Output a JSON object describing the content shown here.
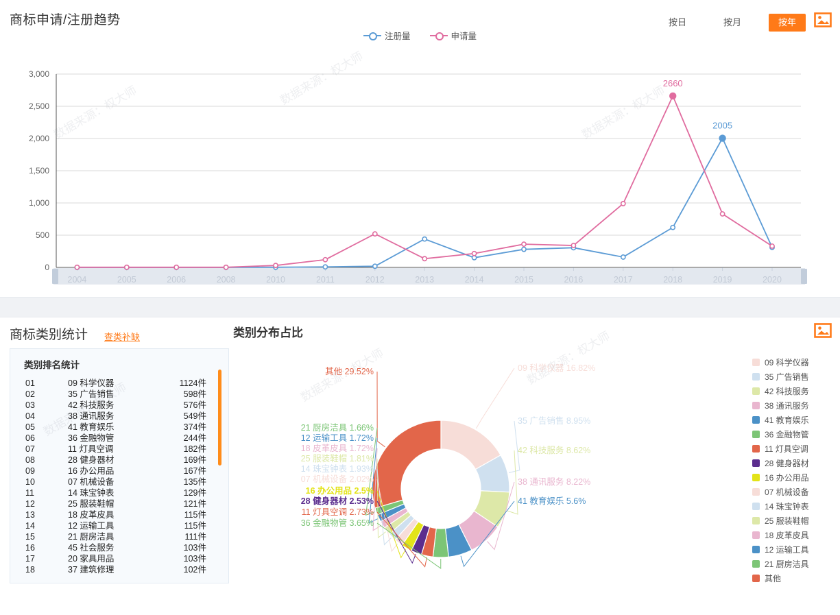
{
  "trend": {
    "title": "商标申请/注册趋势",
    "range_buttons": [
      {
        "label": "按日",
        "active": false
      },
      {
        "label": "按月",
        "active": false
      },
      {
        "label": "按年",
        "active": true
      }
    ],
    "export_icon": "image-export-icon",
    "watermark": "数据来源：权大师",
    "legend": [
      {
        "label": "注册量",
        "color": "#5b9bd5"
      },
      {
        "label": "申请量",
        "color": "#e06c9f"
      }
    ]
  },
  "category": {
    "title": "商标类别统计",
    "link": "查类补缺",
    "export_icon": "image-export-icon",
    "rank_title": "类别排名统计",
    "unit": "件",
    "rank_rows": [
      {
        "idx": "01",
        "name": "09 科学仪器",
        "count": "1124件"
      },
      {
        "idx": "02",
        "name": "35 广告销售",
        "count": "598件"
      },
      {
        "idx": "03",
        "name": "42 科技服务",
        "count": "576件"
      },
      {
        "idx": "04",
        "name": "38 通讯服务",
        "count": "549件"
      },
      {
        "idx": "05",
        "name": "41 教育娱乐",
        "count": "374件"
      },
      {
        "idx": "06",
        "name": "36 金融物管",
        "count": "244件"
      },
      {
        "idx": "07",
        "name": "11 灯具空调",
        "count": "182件"
      },
      {
        "idx": "08",
        "name": "28 健身器材",
        "count": "169件"
      },
      {
        "idx": "09",
        "name": "16 办公用品",
        "count": "167件"
      },
      {
        "idx": "10",
        "name": "07 机械设备",
        "count": "135件"
      },
      {
        "idx": "11",
        "name": "14 珠宝钟表",
        "count": "129件"
      },
      {
        "idx": "12",
        "name": "25 服装鞋帽",
        "count": "121件"
      },
      {
        "idx": "13",
        "name": "18 皮革皮具",
        "count": "115件"
      },
      {
        "idx": "14",
        "name": "12 运输工具",
        "count": "115件"
      },
      {
        "idx": "15",
        "name": "21 厨房洁具",
        "count": "111件"
      },
      {
        "idx": "16",
        "name": "45 社会服务",
        "count": "103件"
      },
      {
        "idx": "17",
        "name": "20 家具用品",
        "count": "103件"
      },
      {
        "idx": "18",
        "name": "37 建筑修理",
        "count": "102件"
      }
    ],
    "donut_title": "类别分布占比"
  },
  "chart_data": [
    {
      "type": "line",
      "title": "商标申请/注册趋势",
      "xlabel": "",
      "ylabel": "",
      "ylim": [
        0,
        3000
      ],
      "yticks": [
        "0",
        "500",
        "1,000",
        "1,500",
        "2,000",
        "2,500",
        "3,000"
      ],
      "grid": true,
      "legend_position": "top-center",
      "categories": [
        "2004",
        "2005",
        "2006",
        "2008",
        "2010",
        "2011",
        "2012",
        "2013",
        "2014",
        "2015",
        "2016",
        "2017",
        "2018",
        "2019",
        "2020"
      ],
      "series": [
        {
          "name": "注册量",
          "color": "#5b9bd5",
          "values": [
            0,
            0,
            0,
            0,
            2,
            8,
            18,
            440,
            150,
            280,
            305,
            160,
            620,
            2005,
            310
          ]
        },
        {
          "name": "申请量",
          "color": "#e06c9f",
          "values": [
            2,
            2,
            2,
            2,
            30,
            120,
            520,
            135,
            215,
            360,
            340,
            990,
            2660,
            830,
            330
          ]
        }
      ],
      "annotations": [
        {
          "label": "2660",
          "series": "申请量",
          "x": "2018",
          "y": 2660,
          "color": "#e06c9f"
        },
        {
          "label": "2005",
          "series": "注册量",
          "x": "2019",
          "y": 2005,
          "color": "#5b9bd5"
        }
      ]
    },
    {
      "type": "pie",
      "title": "类别分布占比",
      "legend_position": "right",
      "labels": [
        "09 科学仪器",
        "35 广告销售",
        "42 科技服务",
        "38 通讯服务",
        "41 教育娱乐",
        "36 金融物管",
        "11 灯具空调",
        "28 健身器材",
        "16 办公用品",
        "07 机械设备",
        "14 珠宝钟表",
        "25 服装鞋帽",
        "18 皮革皮具",
        "12 运输工具",
        "21 厨房洁具",
        "其他"
      ],
      "values": [
        16.82,
        8.95,
        8.62,
        8.22,
        5.6,
        3.65,
        2.73,
        2.53,
        2.5,
        2.02,
        1.93,
        1.81,
        1.72,
        1.72,
        1.66,
        29.52
      ],
      "value_labels": [
        "09 科学仪器 16.82%",
        "35 广告销售 8.95%",
        "42 科技服务 8.62%",
        "38 通讯服务 8.22%",
        "41 教育娱乐 5.6%",
        "36 金融物管 3.65%",
        "11 灯具空调 2.73%",
        "28 健身器材 2.53%",
        "16 办公用品 2.5%",
        "07 机械设备 2.02%",
        "14 珠宝钟表 1.93%",
        "25 服装鞋帽 1.81%",
        "18 皮革皮具 1.72%",
        "12 运输工具 1.72%",
        "21 厨房洁具 1.66%",
        "其他 29.52%"
      ],
      "colors": [
        "#f7ddd8",
        "#cfe0ef",
        "#dde8a8",
        "#e9b6cf",
        "#4b91c7",
        "#7cc576",
        "#e2664a",
        "#5b2d8e",
        "#e3e318",
        "#f7ddd8",
        "#cfe0ef",
        "#dde8a8",
        "#e9b6cf",
        "#4b91c7",
        "#7cc576",
        "#e2664a"
      ]
    }
  ]
}
